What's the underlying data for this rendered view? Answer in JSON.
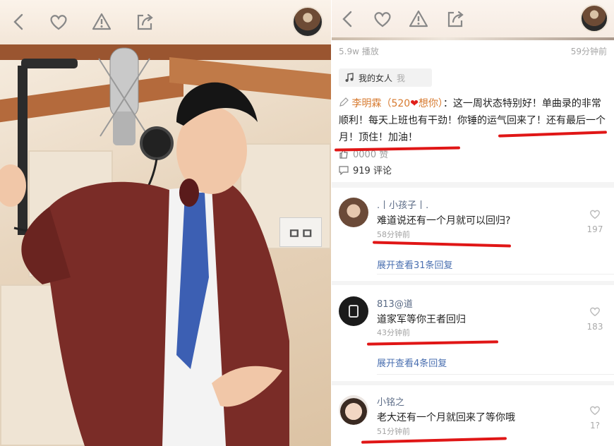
{
  "left": {
    "toolbar": [
      "back-icon",
      "heart-icon",
      "warning-icon",
      "share-icon"
    ],
    "avatar": "user-avatar",
    "photo": {
      "sign_text": "ㅁㅁ"
    }
  },
  "right": {
    "toolbar": [
      "back-icon",
      "heart-icon",
      "warning-icon",
      "share-icon"
    ],
    "play_count": "5.9w 播放",
    "post_time": "59分钟前",
    "music": {
      "icon": "music-note-icon",
      "title": "我的女人"
    },
    "post": {
      "author": "李明霖（520",
      "author_suffix": "想你）",
      "text": "：这一周状态特别好！单曲录的非常顺利！每天上班也有干劲！你锤的运气回来了！还有最后一个月！顶住！加油！"
    },
    "likes_text": "0000 赞",
    "comments_text": "919 评论",
    "comments": [
      {
        "name": ".丨小孩子丨.",
        "text": "难道说还有一个月就可以回归?",
        "time": "58分钟前",
        "likes": "197",
        "replies": "展开查看31条回复"
      },
      {
        "name": "813@道",
        "text": "道家军等你王者回归",
        "time": "43分钟前",
        "likes": "183",
        "replies": "展开查看4条回复"
      },
      {
        "name": "小铭之",
        "text": "老大还有一个月就回来了等你哦",
        "time": "51分钟前",
        "likes": "1?"
      }
    ],
    "colors": {
      "author": "#d77a2f",
      "link": "#4a6fb0",
      "annotation": "#e01616"
    }
  }
}
